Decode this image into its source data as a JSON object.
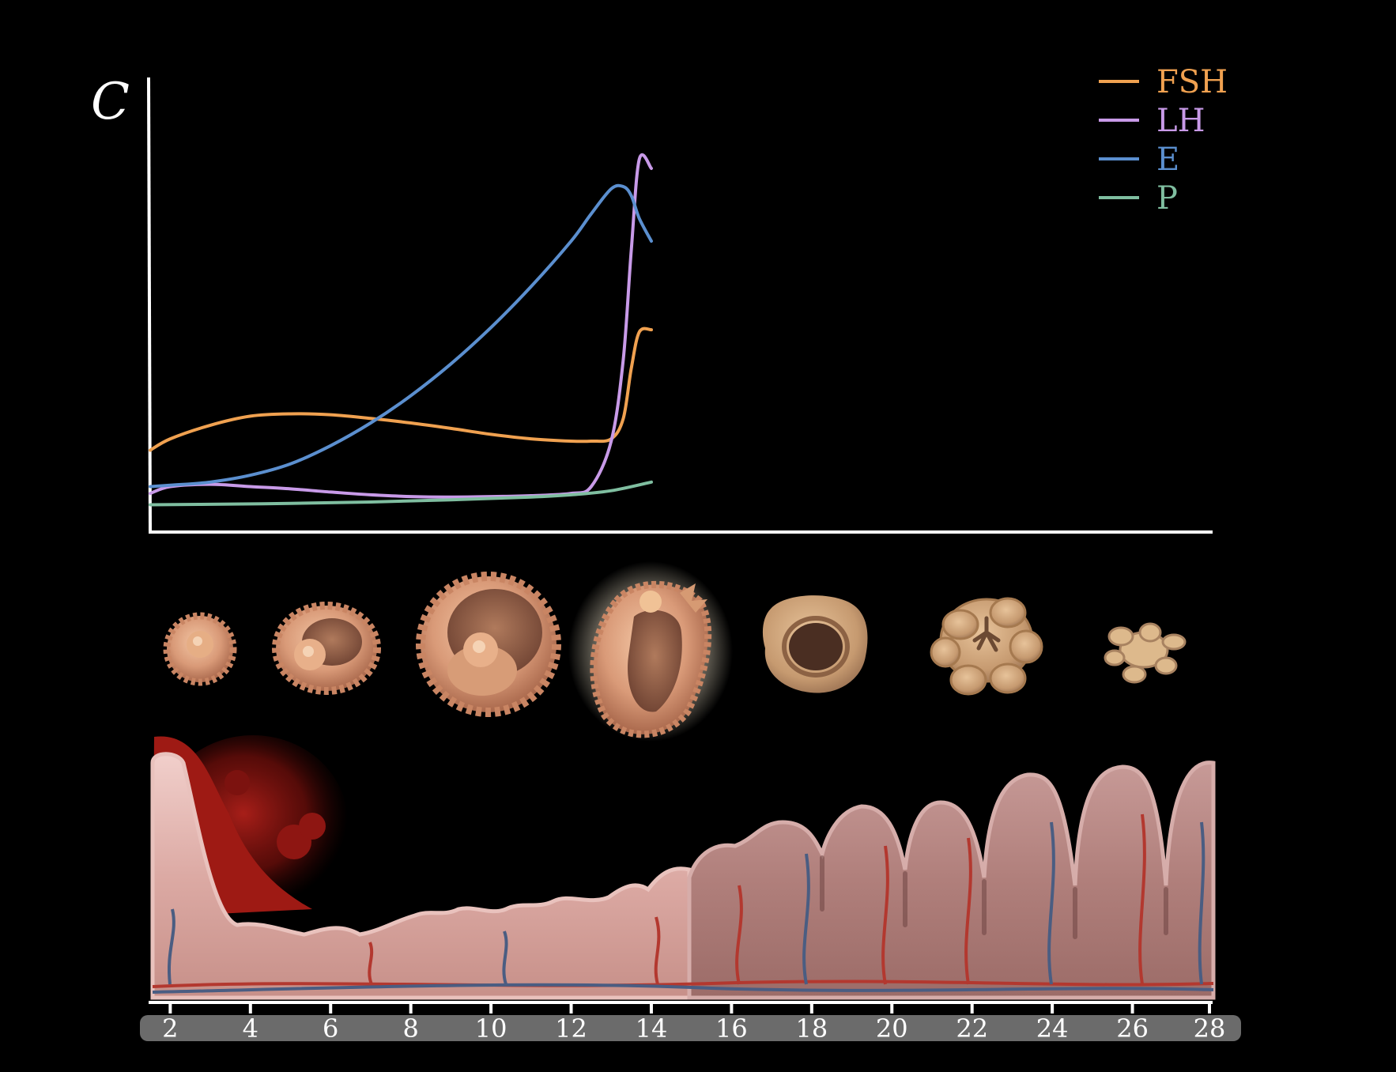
{
  "chart_data": {
    "type": "line",
    "title": "",
    "ylabel": "C",
    "xlabel": "",
    "xlim": [
      1.5,
      28
    ],
    "ylim": [
      0,
      1
    ],
    "x_ticks": [
      2,
      4,
      6,
      8,
      10,
      12,
      14,
      16,
      18,
      20,
      22,
      24,
      26,
      28
    ],
    "legend_position": "top-right",
    "grid": false,
    "series": [
      {
        "name": "FSH",
        "color": "#f0a150",
        "x": [
          1.5,
          2,
          3,
          4,
          5,
          6,
          7,
          8,
          9,
          10,
          11,
          12,
          12.5,
          13,
          13.3,
          13.5,
          13.7,
          14
        ],
        "y": [
          0.18,
          0.205,
          0.235,
          0.255,
          0.26,
          0.258,
          0.25,
          0.24,
          0.228,
          0.215,
          0.205,
          0.2,
          0.2,
          0.205,
          0.25,
          0.36,
          0.44,
          0.445
        ]
      },
      {
        "name": "LH",
        "color": "#c89ae8",
        "x": [
          1.5,
          2,
          3,
          4,
          5,
          6,
          7,
          8,
          9,
          10,
          11,
          12,
          12.5,
          13,
          13.3,
          13.5,
          13.7,
          14
        ],
        "y": [
          0.085,
          0.1,
          0.105,
          0.1,
          0.095,
          0.088,
          0.082,
          0.078,
          0.077,
          0.078,
          0.08,
          0.085,
          0.1,
          0.2,
          0.38,
          0.62,
          0.82,
          0.8
        ]
      },
      {
        "name": "E",
        "color": "#5b8fcf",
        "x": [
          1.5,
          2,
          3,
          4,
          5,
          6,
          7,
          8,
          9,
          10,
          11,
          12,
          12.5,
          13,
          13.3,
          13.5,
          13.7,
          14
        ],
        "y": [
          0.1,
          0.103,
          0.11,
          0.125,
          0.15,
          0.19,
          0.24,
          0.3,
          0.37,
          0.45,
          0.54,
          0.64,
          0.7,
          0.755,
          0.76,
          0.74,
          0.69,
          0.64
        ]
      },
      {
        "name": "P",
        "color": "#7fbea0",
        "x": [
          1.5,
          3,
          5,
          7,
          9,
          11,
          12,
          13,
          14
        ],
        "y": [
          0.06,
          0.061,
          0.063,
          0.066,
          0.071,
          0.077,
          0.082,
          0.091,
          0.11
        ]
      }
    ]
  },
  "ovary_stages": [
    "primordial-follicle",
    "primary-follicle",
    "secondary-follicle",
    "ovulating-follicle",
    "corpus-luteum",
    "regressing-corpus-luteum",
    "corpus-albicans"
  ],
  "colors": {
    "background": "#000000",
    "axis": "#ffffff",
    "tick_bar": "#6b6b6b",
    "endometrium": "#d9a8a2",
    "endometrium_dark": "#b98683",
    "menses_blood": "#9e1a14"
  }
}
